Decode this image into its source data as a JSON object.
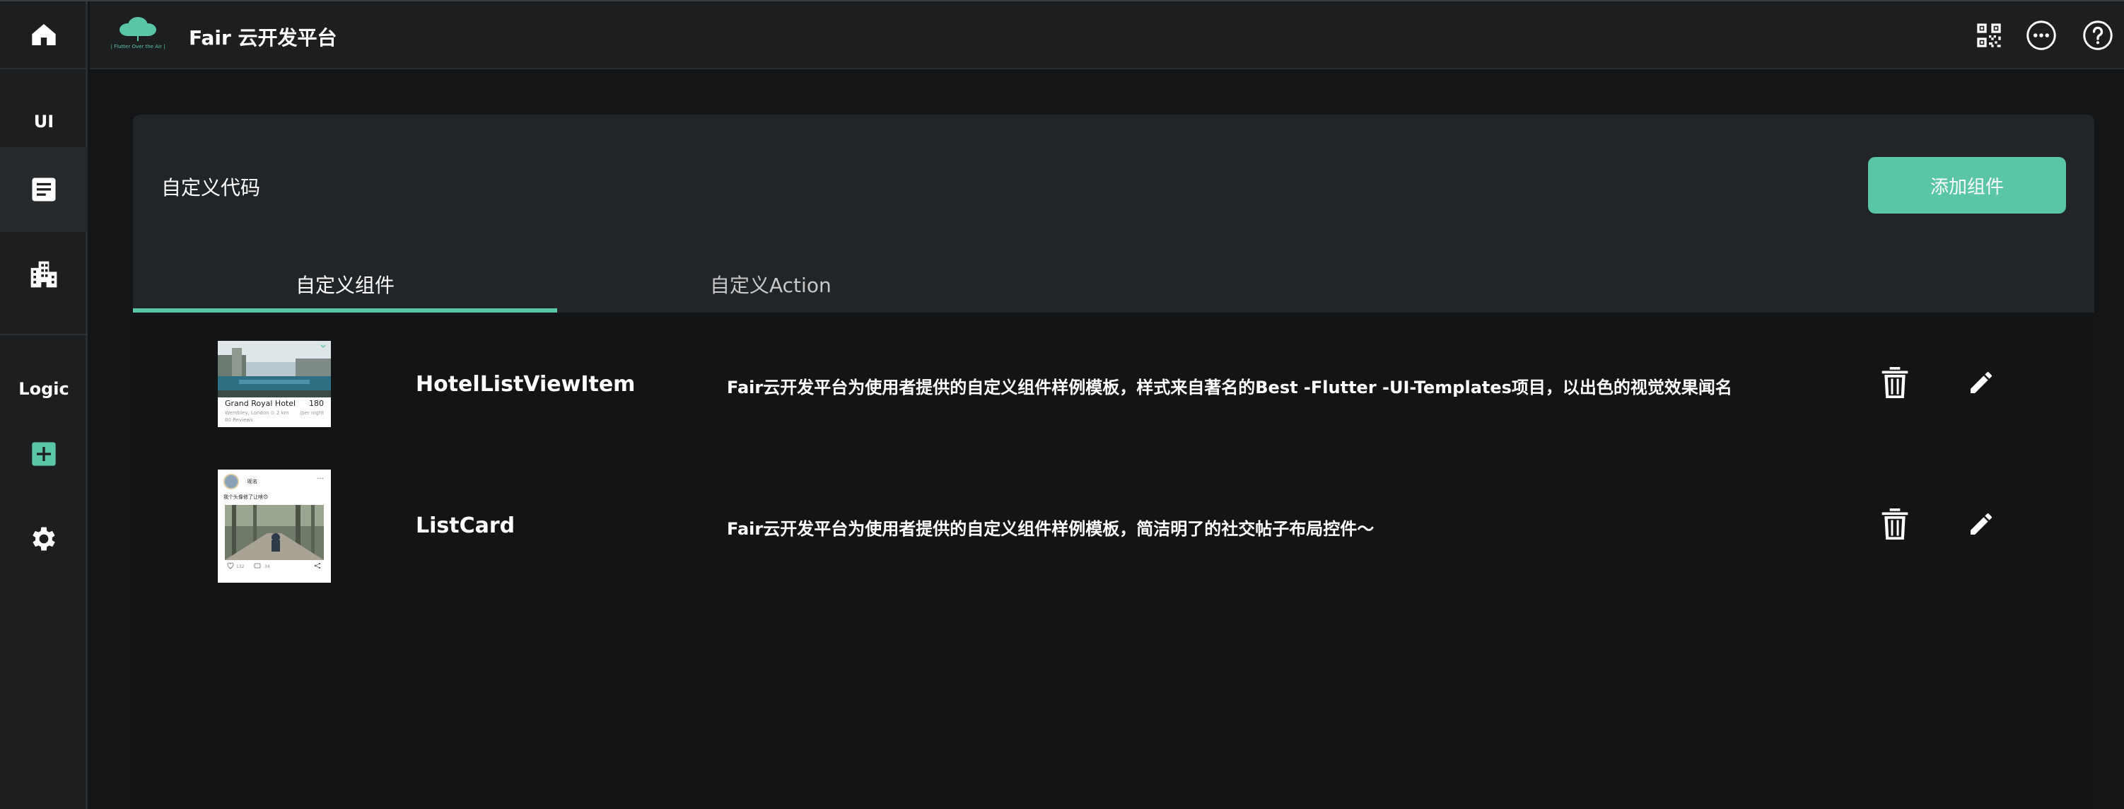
{
  "app": {
    "title": "Fair 云开发平台",
    "logo_text": "| Flutter Over the Air |",
    "accent_color": "#5bc6a6"
  },
  "sidebar": {
    "sections": [
      {
        "label": "UI",
        "items": [
          "document-icon",
          "building-icon"
        ]
      },
      {
        "label": "Logic",
        "items": [
          "add-box-icon",
          "gear-icon"
        ]
      }
    ],
    "home_icon": "home-icon"
  },
  "header_icons": [
    "qr-code-icon",
    "more-icon",
    "help-icon"
  ],
  "panel": {
    "title": "自定义代码",
    "add_button": "添加组件",
    "tabs": [
      {
        "label": "自定义组件",
        "active": true
      },
      {
        "label": "自定义Action",
        "active": false
      }
    ]
  },
  "components": [
    {
      "name": "HotelListViewItem",
      "description": "Fair云开发平台为使用者提供的自定义组件样例模板，样式来自著名的Best -Flutter -UI-Templates项目，以出色的视觉效果闻名",
      "thumbnail": {
        "title": "Grand Royal Hotel",
        "price": "180",
        "subtitle": "Wembley, London  ⊙ 2 km",
        "per_night": "/per night",
        "reviews": "80 Reviews"
      }
    },
    {
      "name": "ListCard",
      "description": "Fair云开发平台为使用者提供的自定义组件样例模板，简洁明了的社交帖子布局控件～",
      "thumbnail": {
        "user": "昵名",
        "text": "我个头像修了让啥😊",
        "likes": "132",
        "comments": "34"
      }
    }
  ]
}
